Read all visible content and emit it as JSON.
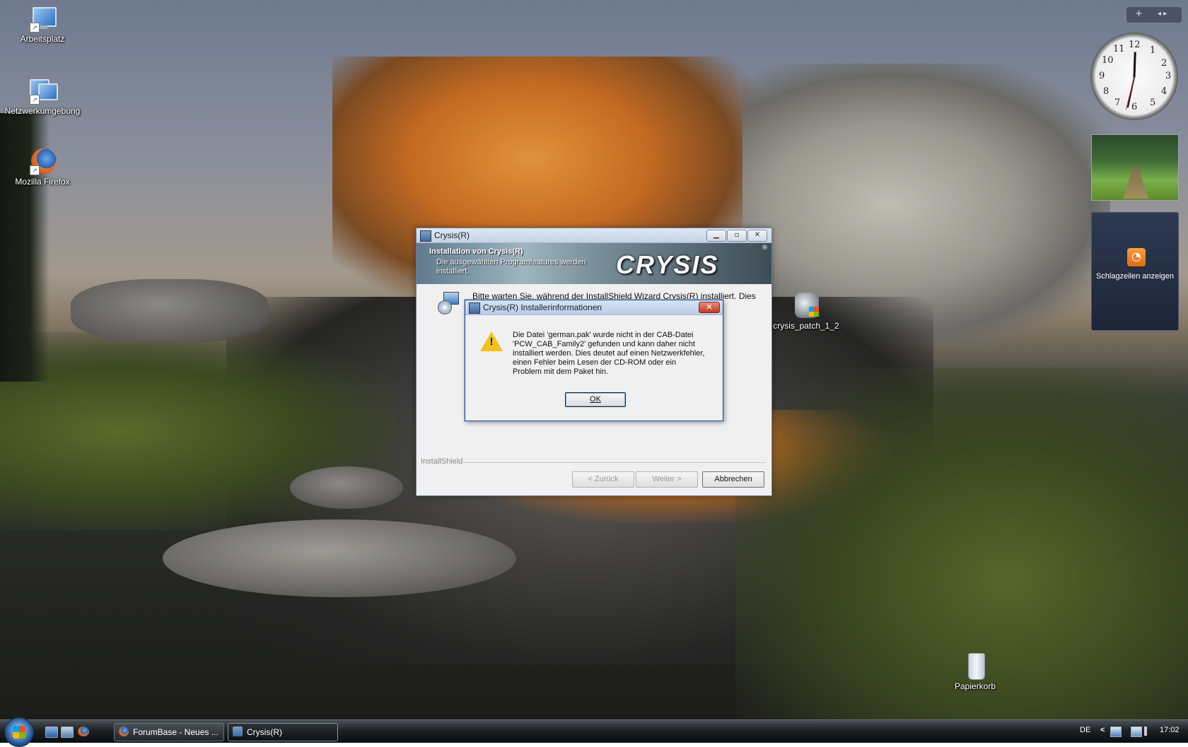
{
  "desktop": {
    "icons": [
      {
        "label": "Arbeitsplatz"
      },
      {
        "label": "Netzwerkumgebung"
      },
      {
        "label": "Mozilla Firefox"
      },
      {
        "label": "crysis_patch_1_2"
      },
      {
        "label": "Papierkorb"
      }
    ]
  },
  "sidebar": {
    "top_add": "+",
    "top_nav": "◂ ▸",
    "clock_numbers": [
      "12",
      "1",
      "2",
      "3",
      "4",
      "5",
      "6",
      "7",
      "8",
      "9",
      "10",
      "11"
    ],
    "feed_label": "Schlagzeilen anzeigen"
  },
  "installer": {
    "title": "Crysis(R)",
    "banner_title": "Installation von Crysis(R)",
    "banner_subtitle": "Die ausgewählten Programfeatures werden installiert.",
    "logo": "CRYSIS",
    "logo_mark": "®",
    "body_text": "Bitte warten Sie, während der InstallShield Wizard Crysis(R) installiert. Dies",
    "installshield_label": "InstallShield",
    "back_button": "< Zurück",
    "next_button": "Weiter >",
    "cancel_button": "Abbrechen"
  },
  "error_dialog": {
    "title": "Crysis(R) Installerinformationen",
    "message": "Die Datei 'german.pak' wurde nicht in der CAB-Datei 'PCW_CAB_Family2' gefunden und kann daher nicht installiert werden. Dies deutet auf einen Netzwerkfehler, einen Fehler beim Lesen der CD-ROM oder ein Problem mit dem Paket hin.",
    "ok_button": "OK"
  },
  "taskbar": {
    "tasks": [
      {
        "label": "ForumBase - Neues ..."
      },
      {
        "label": "Crysis(R)"
      }
    ],
    "language": "DE",
    "tray_arrow": "<",
    "clock": "17:02"
  }
}
